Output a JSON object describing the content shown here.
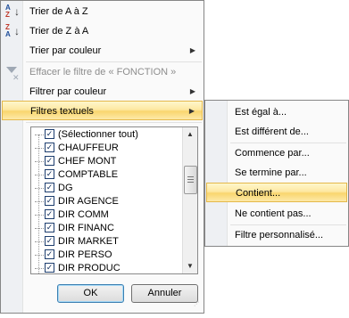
{
  "menu": {
    "items": [
      {
        "label": "Trier de A à Z",
        "icon": "sort-az-icon"
      },
      {
        "label": "Trier de Z à A",
        "icon": "sort-za-icon"
      },
      {
        "label": "Trier par couleur",
        "has_submenu": true
      },
      {
        "label": "Effacer le filtre de « FONCTION »",
        "disabled": true,
        "icon": "clear-filter-icon"
      },
      {
        "label": "Filtrer par couleur",
        "has_submenu": true
      },
      {
        "label": "Filtres textuels",
        "has_submenu": true,
        "highlighted": true
      }
    ]
  },
  "values_list": {
    "items": [
      {
        "label": "(Sélectionner tout)",
        "checked": true
      },
      {
        "label": "CHAUFFEUR",
        "checked": true
      },
      {
        "label": "CHEF MONT",
        "checked": true
      },
      {
        "label": "COMPTABLE",
        "checked": true
      },
      {
        "label": "DG",
        "checked": true
      },
      {
        "label": "DIR AGENCE",
        "checked": true
      },
      {
        "label": "DIR COMM",
        "checked": true
      },
      {
        "label": "DIR FINANC",
        "checked": true
      },
      {
        "label": "DIR MARKET",
        "checked": true
      },
      {
        "label": "DIR PERSO",
        "checked": true
      },
      {
        "label": "DIR PRODUC",
        "checked": true
      }
    ]
  },
  "buttons": {
    "ok": "OK",
    "cancel": "Annuler"
  },
  "submenu": {
    "items": [
      {
        "label": "Est égal à..."
      },
      {
        "label": "Est différent de..."
      },
      {
        "label": "Commence par..."
      },
      {
        "label": "Se termine par..."
      },
      {
        "label": "Contient...",
        "highlighted": true
      },
      {
        "label": "Ne contient pas..."
      },
      {
        "label": "Filtre personnalisé..."
      }
    ]
  },
  "colors": {
    "highlight": "#f9d66e",
    "highlight_border": "#e4b84a",
    "menu_bg": "#fafafa",
    "gutter": "#eef0f3"
  }
}
